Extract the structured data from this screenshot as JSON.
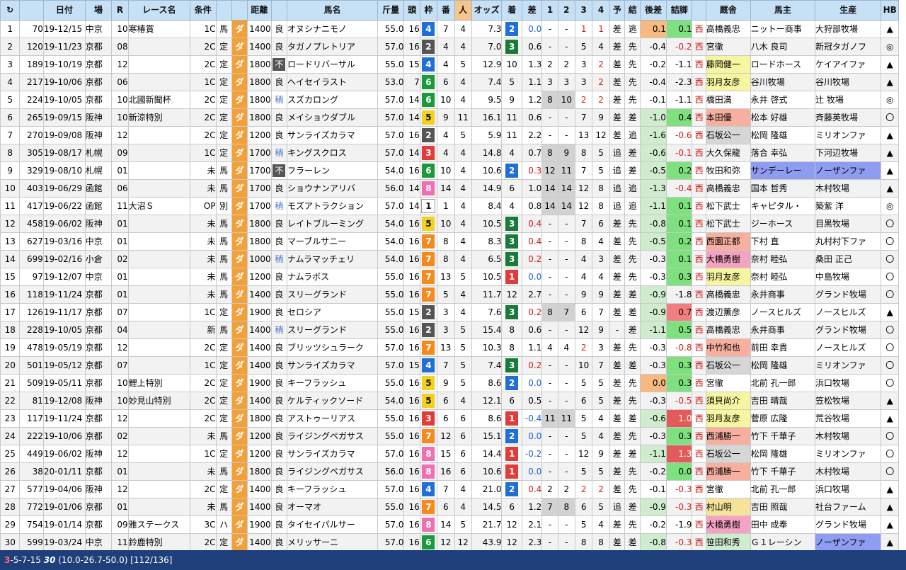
{
  "headers": [
    "↻",
    "",
    "日付",
    "場",
    "R",
    "レース名",
    "条件",
    "",
    "",
    "距離",
    "",
    "馬名",
    "斤量",
    "頭",
    "枠",
    "番",
    "人",
    "オッズ",
    "着",
    "差",
    "1",
    "2",
    "3",
    "4",
    "予",
    "結",
    "後差",
    "詰脚",
    "",
    "厩舎",
    "馬主",
    "生産",
    "HB"
  ],
  "rows": [
    [
      "1",
      "70",
      "19-12/15",
      "中京",
      "10",
      "寒椿賞",
      "1C",
      "馬",
      "ダ",
      "1400",
      "良",
      "オヌシナニモノ",
      "55.0",
      "16",
      "4",
      "7",
      "4",
      "7.3",
      "2",
      "0.0",
      "-",
      "-",
      "1",
      "1",
      "差",
      "逃",
      "0.1",
      "0.1",
      "西",
      "高橋義忠",
      "ニットー商事",
      "大狩部牧場",
      "▲"
    ],
    [
      "2",
      "120",
      "19-11/23",
      "京都",
      "08",
      "",
      "2C",
      "定",
      "ダ",
      "1400",
      "良",
      "タガノプレトリア",
      "57.0",
      "16",
      "2",
      "4",
      "4",
      "7.0",
      "3",
      "0.6",
      "-",
      "-",
      "5",
      "4",
      "差",
      "先",
      "-0.4",
      "-0.2",
      "西",
      "宮徹",
      "八木 良司",
      "新冠タガノフ",
      "◎"
    ],
    [
      "3",
      "189",
      "19-10/19",
      "京都",
      "12",
      "",
      "2C",
      "定",
      "ダ",
      "1800",
      "不",
      "ロードリバーサル",
      "55.0",
      "15",
      "4",
      "4",
      "5",
      "12.9",
      "10",
      "1.3",
      "2",
      "2",
      "3",
      "2",
      "差",
      "先",
      "-0.2",
      "-1.1",
      "西",
      "藤岡健一",
      "ロードホース",
      "ケイアイファ",
      "▲"
    ],
    [
      "4",
      "217",
      "19-10/06",
      "京都",
      "06",
      "",
      "1C",
      "定",
      "ダ",
      "1800",
      "良",
      "ヘイセイラスト",
      "53.0",
      "7",
      "6",
      "6",
      "4",
      "7.4",
      "5",
      "1.1",
      "3",
      "3",
      "3",
      "2",
      "差",
      "先",
      "-0.4",
      "-2.3",
      "西",
      "羽月友彦",
      "谷川牧場",
      "谷川牧場",
      "▲"
    ],
    [
      "5",
      "224",
      "19-10/05",
      "京都",
      "10",
      "北國新聞杯",
      "2C",
      "定",
      "ダ",
      "1800",
      "稍",
      "スズカロング",
      "57.0",
      "14",
      "6",
      "10",
      "4",
      "9.5",
      "9",
      "1.2",
      "8",
      "10",
      "2",
      "2",
      "差",
      "先",
      "-0.1",
      "-1.1",
      "西",
      "橋田満",
      "永井 啓式",
      "辻 牧場",
      "◎"
    ],
    [
      "6",
      "265",
      "19-09/15",
      "阪神",
      "10",
      "新涼特別",
      "2C",
      "定",
      "ダ",
      "1800",
      "良",
      "メイショウダブル",
      "57.0",
      "14",
      "5",
      "9",
      "11",
      "16.1",
      "11",
      "0.6",
      "-",
      "-",
      "7",
      "9",
      "差",
      "差",
      "-1.0",
      "0.4",
      "西",
      "本田優",
      "松本 好雄",
      "斉藤英牧場",
      "〇"
    ],
    [
      "7",
      "270",
      "19-09/08",
      "阪神",
      "12",
      "",
      "2C",
      "定",
      "ダ",
      "1200",
      "良",
      "サンライズカラマ",
      "57.0",
      "16",
      "2",
      "4",
      "5",
      "5.9",
      "11",
      "2.2",
      "-",
      "-",
      "13",
      "12",
      "差",
      "追",
      "-1.6",
      "-0.6",
      "西",
      "石坂公一",
      "松岡 隆雄",
      "ミリオンファ",
      "▲"
    ],
    [
      "8",
      "305",
      "19-08/17",
      "札幌",
      "09",
      "",
      "1C",
      "定",
      "ダ",
      "1700",
      "稍",
      "キングスクロス",
      "57.0",
      "14",
      "3",
      "4",
      "4",
      "14.8",
      "4",
      "0.7",
      "8",
      "9",
      "8",
      "5",
      "追",
      "差",
      "-0.6",
      "-0.1",
      "西",
      "大久保龍",
      "落合 幸弘",
      "下河辺牧場",
      "▲"
    ],
    [
      "9",
      "329",
      "19-08/10",
      "札幌",
      "01",
      "",
      "未",
      "馬",
      "ダ",
      "1700",
      "不",
      "フラーレン",
      "54.0",
      "16",
      "6",
      "10",
      "4",
      "10.6",
      "2",
      "0.3",
      "12",
      "11",
      "7",
      "5",
      "追",
      "差",
      "-0.5",
      "0.2",
      "西",
      "牧田和弥",
      "サンデーレー",
      "ノーザンファ",
      "▲"
    ],
    [
      "10",
      "403",
      "19-06/29",
      "函館",
      "06",
      "",
      "未",
      "馬",
      "ダ",
      "1700",
      "良",
      "ショウナンアリバ",
      "56.0",
      "14",
      "8",
      "14",
      "4",
      "14.9",
      "6",
      "1.0",
      "14",
      "14",
      "12",
      "8",
      "追",
      "追",
      "-1.3",
      "-0.4",
      "西",
      "高橋義忠",
      "国本 哲秀",
      "木村牧場",
      "▲"
    ],
    [
      "11",
      "417",
      "19-06/22",
      "函館",
      "11",
      "大沼Ｓ",
      "OP",
      "別",
      "ダ",
      "1700",
      "稍",
      "モズアトラクション",
      "57.0",
      "14",
      "1",
      "1",
      "4",
      "8.4",
      "4",
      "0.8",
      "14",
      "14",
      "12",
      "8",
      "追",
      "追",
      "-1.1",
      "0.1",
      "西",
      "松下武士",
      "キャピタル・",
      "築紫 洋",
      "◎"
    ],
    [
      "12",
      "458",
      "19-06/02",
      "阪神",
      "01",
      "",
      "未",
      "馬",
      "ダ",
      "1800",
      "良",
      "レイトブルーミング",
      "54.0",
      "16",
      "5",
      "10",
      "4",
      "10.5",
      "3",
      "0.4",
      "-",
      "-",
      "7",
      "6",
      "差",
      "先",
      "-0.8",
      "0.1",
      "西",
      "松下武士",
      "ジーホース",
      "目黒牧場",
      "〇"
    ],
    [
      "13",
      "627",
      "19-03/16",
      "中京",
      "01",
      "",
      "未",
      "馬",
      "ダ",
      "1800",
      "良",
      "マーブルサニー",
      "54.0",
      "16",
      "7",
      "8",
      "4",
      "8.3",
      "3",
      "0.4",
      "-",
      "-",
      "8",
      "4",
      "差",
      "先",
      "-0.5",
      "0.2",
      "西",
      "西園正都",
      "下村 直",
      "丸村村下ファ",
      "〇"
    ],
    [
      "14",
      "699",
      "19-02/16",
      "小倉",
      "02",
      "",
      "未",
      "馬",
      "ダ",
      "1000",
      "稍",
      "ナムラマッチェリ",
      "54.0",
      "16",
      "7",
      "8",
      "4",
      "6.5",
      "3",
      "0.2",
      "-",
      "-",
      "4",
      "3",
      "差",
      "先",
      "-0.3",
      "0.1",
      "西",
      "大橋勇樹",
      "奈村 睦弘",
      "桑田 正己",
      "〇"
    ],
    [
      "15",
      "97",
      "19-12/07",
      "中京",
      "01",
      "",
      "未",
      "馬",
      "ダ",
      "1200",
      "良",
      "ナムラボス",
      "55.0",
      "16",
      "7",
      "13",
      "5",
      "10.5",
      "1",
      "0.0",
      "-",
      "-",
      "4",
      "4",
      "差",
      "先",
      "-0.3",
      "0.3",
      "西",
      "羽月友彦",
      "奈村 睦弘",
      "中島牧場",
      "〇"
    ],
    [
      "16",
      "118",
      "19-11/24",
      "京都",
      "01",
      "",
      "未",
      "馬",
      "ダ",
      "1400",
      "良",
      "スリーグランド",
      "55.0",
      "16",
      "7",
      "5",
      "4",
      "11.7",
      "12",
      "2.7",
      "-",
      "-",
      "9",
      "9",
      "差",
      "差",
      "-0.9",
      "-1.8",
      "西",
      "高橋義忠",
      "永井商事",
      "グランド牧場",
      "〇"
    ],
    [
      "17",
      "126",
      "19-11/17",
      "京都",
      "07",
      "",
      "1C",
      "定",
      "ダ",
      "1900",
      "良",
      "セロシア",
      "55.0",
      "15",
      "2",
      "3",
      "4",
      "7.6",
      "3",
      "0.2",
      "8",
      "7",
      "6",
      "7",
      "差",
      "差",
      "-0.9",
      "0.7",
      "西",
      "渡辺薫彦",
      "ノースヒルズ",
      "ノースヒルズ",
      "▲"
    ],
    [
      "18",
      "228",
      "19-10/05",
      "京都",
      "04",
      "",
      "新",
      "馬",
      "ダ",
      "1400",
      "稍",
      "スリーグランド",
      "55.0",
      "16",
      "2",
      "3",
      "5",
      "15.4",
      "8",
      "0.6",
      "-",
      "-",
      "12",
      "9",
      "-",
      "差",
      "-1.1",
      "0.5",
      "西",
      "高橋義忠",
      "永井商事",
      "グランド牧場",
      "〇"
    ],
    [
      "19",
      "478",
      "19-05/19",
      "京都",
      "12",
      "",
      "2C",
      "定",
      "ダ",
      "1400",
      "良",
      "ブリッツシュラーク",
      "57.0",
      "16",
      "7",
      "13",
      "5",
      "10.3",
      "8",
      "1.1",
      "4",
      "4",
      "2",
      "3",
      "差",
      "先",
      "-0.3",
      "-0.8",
      "西",
      "中竹和也",
      "前田 幸貴",
      "ノースヒルズ",
      "〇"
    ],
    [
      "20",
      "501",
      "19-05/12",
      "京都",
      "07",
      "",
      "1C",
      "定",
      "ダ",
      "1400",
      "良",
      "サンライズカラマ",
      "57.0",
      "15",
      "4",
      "7",
      "5",
      "7.4",
      "3",
      "0.2",
      "-",
      "-",
      "10",
      "7",
      "差",
      "差",
      "-0.3",
      "0.3",
      "西",
      "石坂公一",
      "松岡 隆雄",
      "ミリオンファ",
      "〇"
    ],
    [
      "21",
      "509",
      "19-05/11",
      "京都",
      "10",
      "鯉上特別",
      "2C",
      "定",
      "ダ",
      "1900",
      "良",
      "キーフラッシュ",
      "55.0",
      "16",
      "5",
      "9",
      "5",
      "8.6",
      "2",
      "0.0",
      "-",
      "-",
      "5",
      "5",
      "差",
      "先",
      "0.0",
      "0.3",
      "西",
      "宮徹",
      "北前 孔一郎",
      "浜口牧場",
      "〇"
    ],
    [
      "22",
      "81",
      "19-12/08",
      "阪神",
      "10",
      "妙見山特別",
      "2C",
      "定",
      "ダ",
      "1400",
      "良",
      "ケルティックソード",
      "54.0",
      "16",
      "5",
      "6",
      "4",
      "12.1",
      "6",
      "0.5",
      "-",
      "-",
      "6",
      "5",
      "差",
      "先",
      "-0.3",
      "-0.5",
      "西",
      "須貝尚介",
      "吉田 晴哉",
      "笠松牧場",
      "▲"
    ],
    [
      "23",
      "117",
      "19-11/24",
      "京都",
      "12",
      "",
      "2C",
      "定",
      "ダ",
      "1800",
      "良",
      "アストゥーリアス",
      "55.0",
      "16",
      "3",
      "6",
      "6",
      "8.6",
      "1",
      "-0.4",
      "11",
      "11",
      "5",
      "4",
      "差",
      "差",
      "-0.6",
      "1.0",
      "西",
      "羽月友彦",
      "菅原 広隆",
      "荒谷牧場",
      "▲"
    ],
    [
      "24",
      "222",
      "19-10/06",
      "京都",
      "02",
      "",
      "未",
      "馬",
      "ダ",
      "1200",
      "良",
      "ライジングペガサス",
      "55.0",
      "16",
      "7",
      "12",
      "6",
      "15.1",
      "2",
      "0.0",
      "-",
      "-",
      "5",
      "4",
      "差",
      "先",
      "-0.3",
      "0.3",
      "西",
      "西浦勝一",
      "竹下 千華子",
      "木村牧場",
      "〇"
    ],
    [
      "25",
      "449",
      "19-06/02",
      "阪神",
      "12",
      "",
      "1C",
      "定",
      "ダ",
      "1200",
      "良",
      "サンライズカラマ",
      "57.0",
      "16",
      "8",
      "15",
      "6",
      "14.4",
      "1",
      "-0.2",
      "-",
      "-",
      "12",
      "9",
      "差",
      "差",
      "-1.1",
      "1.3",
      "西",
      "石坂公一",
      "松岡 隆雄",
      "ミリオンファ",
      "〇"
    ],
    [
      "26",
      "38",
      "20-01/11",
      "京都",
      "01",
      "",
      "未",
      "馬",
      "ダ",
      "1800",
      "良",
      "ライジングペガサス",
      "56.0",
      "16",
      "8",
      "16",
      "6",
      "10.6",
      "1",
      "0.0",
      "-",
      "-",
      "5",
      "5",
      "差",
      "先",
      "-0.2",
      "0.0",
      "西",
      "西浦勝一",
      "竹下 千華子",
      "木村牧場",
      "〇"
    ],
    [
      "27",
      "577",
      "19-04/06",
      "阪神",
      "12",
      "",
      "2C",
      "定",
      "ダ",
      "1400",
      "良",
      "キーフラッシュ",
      "57.0",
      "16",
      "4",
      "7",
      "4",
      "21.0",
      "2",
      "0.4",
      "2",
      "2",
      "2",
      "2",
      "差",
      "先",
      "-0.1",
      "-0.3",
      "西",
      "宮徹",
      "北前 孔一郎",
      "浜口牧場",
      "▲"
    ],
    [
      "28",
      "772",
      "19-01/06",
      "京都",
      "01",
      "",
      "未",
      "馬",
      "ダ",
      "1400",
      "良",
      "オーマオ",
      "55.0",
      "16",
      "7",
      "6",
      "4",
      "14.5",
      "6",
      "1.2",
      "7",
      "8",
      "6",
      "5",
      "追",
      "差",
      "-0.9",
      "-0.3",
      "西",
      "村山明",
      "吉田 照哉",
      "社台ファーム",
      "▲"
    ],
    [
      "29",
      "754",
      "19-01/14",
      "京都",
      "09",
      "雅ステークス",
      "3C",
      "ハ",
      "ダ",
      "1900",
      "良",
      "タイセイパルサー",
      "57.0",
      "16",
      "8",
      "14",
      "5",
      "21.7",
      "12",
      "2.1",
      "-",
      "-",
      "5",
      "4",
      "差",
      "先",
      "-0.2",
      "-1.9",
      "西",
      "大橋勇樹",
      "田中 成奉",
      "グランド牧場",
      "▲"
    ],
    [
      "30",
      "599",
      "19-03/24",
      "中京",
      "11",
      "鈴鹿特別",
      "2C",
      "定",
      "ダ",
      "1400",
      "良",
      "メリッサーニ",
      "57.0",
      "16",
      "6",
      "12",
      "12",
      "43.9",
      "12",
      "2.3",
      "-",
      "-",
      "8",
      "8",
      "差",
      "差",
      "-0.8",
      "-0.3",
      "西",
      "笹田和秀",
      "Ｇ１レーシン",
      "ノーザンファ",
      "▲"
    ]
  ],
  "status": {
    "code_red": "3",
    "code_rest": "-5-7-15",
    "count": "30",
    "summary": "(10.0-26.7-50.0) [112/136]"
  }
}
